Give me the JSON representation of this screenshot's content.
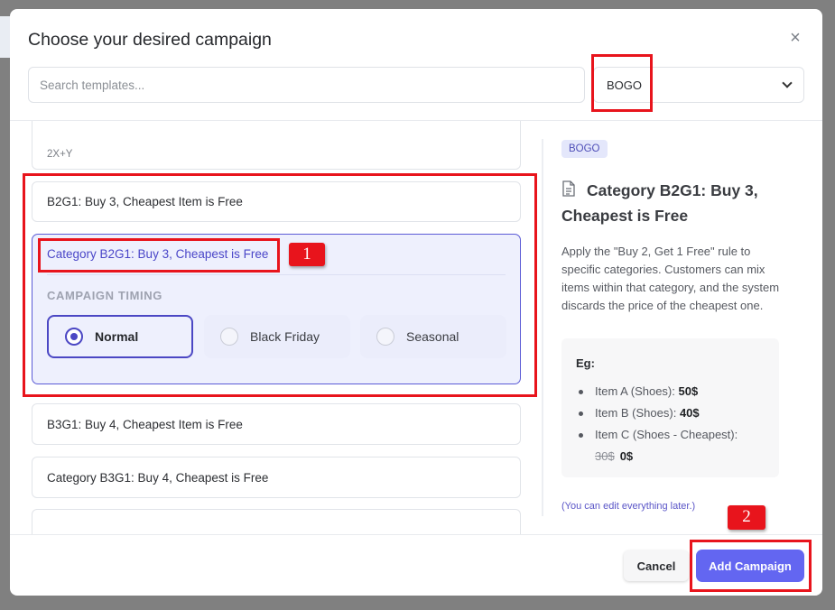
{
  "modal": {
    "title": "Choose your desired campaign",
    "close_glyph": "×"
  },
  "search": {
    "placeholder": "Search templates..."
  },
  "category_select": {
    "value": "BOGO"
  },
  "templates": {
    "partial_subtitle": "2X+Y",
    "items": [
      {
        "label": "B2G1: Buy 3, Cheapest Item is Free"
      },
      {
        "label": "Category B2G1: Buy 3, Cheapest is Free"
      },
      {
        "label": "B3G1: Buy 4, Cheapest Item is Free"
      },
      {
        "label": "Category B3G1: Buy 4, Cheapest is Free"
      }
    ]
  },
  "timing": {
    "label": "CAMPAIGN TIMING",
    "options": [
      {
        "label": "Normal",
        "selected": true
      },
      {
        "label": "Black Friday",
        "selected": false
      },
      {
        "label": "Seasonal",
        "selected": false
      }
    ]
  },
  "preview": {
    "badge": "BOGO",
    "title": "Category B2G1: Buy 3, Cheapest is Free",
    "description": "Apply the \"Buy 2, Get 1 Free\" rule to specific categories. Customers can mix items within that category, and the system discards the price of the cheapest one.",
    "example": {
      "label": "Eg:",
      "items": [
        {
          "name": "Item A (Shoes):",
          "price": "50$"
        },
        {
          "name": "Item B (Shoes):",
          "price": "40$"
        },
        {
          "name": "Item C (Shoes - Cheapest):",
          "old_price": "30$",
          "price": "0$"
        }
      ]
    },
    "note": "(You can edit everything later.)"
  },
  "footer": {
    "cancel_label": "Cancel",
    "add_label": "Add Campaign"
  },
  "annotations": {
    "marker_1": "1",
    "marker_2": "2",
    "color": "#e8141c"
  },
  "colors": {
    "accent": "#6366f1",
    "active_border": "#5b5bd6",
    "active_bg": "#eef0fd"
  }
}
